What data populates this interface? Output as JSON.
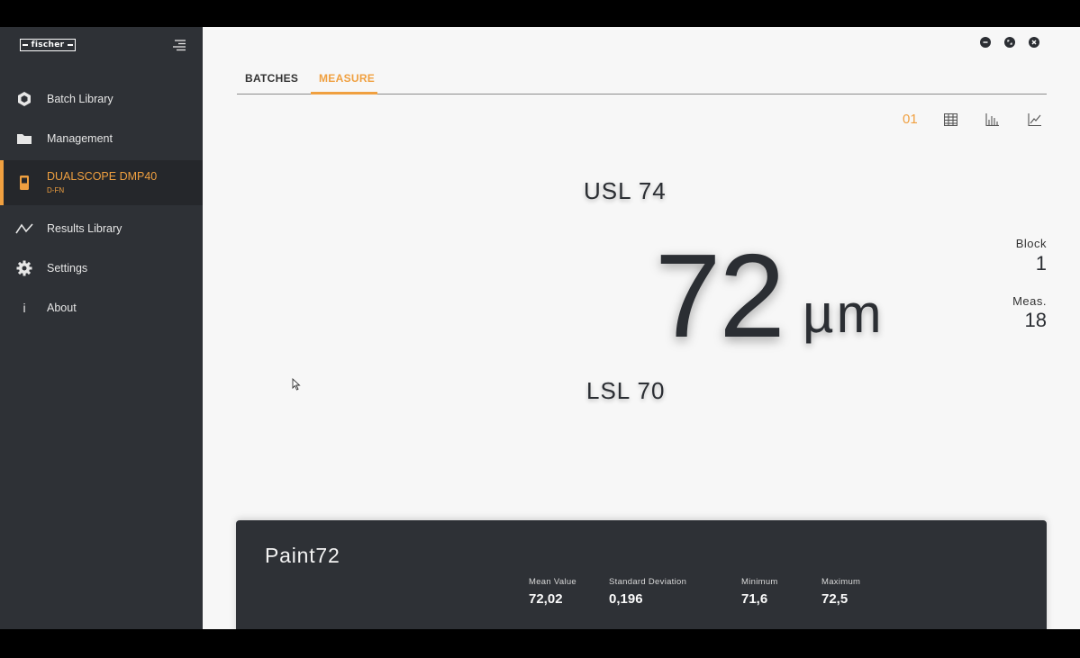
{
  "sidebar": {
    "logo_text": "fischer",
    "items": [
      {
        "label": "Batch Library",
        "icon": "hexagon-icon"
      },
      {
        "label": "Management",
        "icon": "folder-icon"
      },
      {
        "label": "DUALSCOPE DMP40",
        "sublabel": "D-FN",
        "icon": "device-icon",
        "active": true
      },
      {
        "label": "Results Library",
        "icon": "chart-line-icon"
      },
      {
        "label": "Settings",
        "icon": "gear-icon"
      },
      {
        "label": "About",
        "icon": "info-icon"
      }
    ]
  },
  "tabs": [
    {
      "label": "BATCHES",
      "active": false
    },
    {
      "label": "MEASURE",
      "active": true
    }
  ],
  "view_modes": {
    "single_label": "01",
    "icons": [
      "table-icon",
      "histogram-icon",
      "trend-chart-icon"
    ]
  },
  "measurement": {
    "usl": "USL 74",
    "lsl": "LSL 70",
    "value": "72",
    "unit": "µm",
    "block_label": "Block",
    "block_value": "1",
    "meas_label": "Meas.",
    "meas_value": "18"
  },
  "batch": {
    "name": "Paint72",
    "stats": [
      {
        "label": "Mean Value",
        "value": "72,02"
      },
      {
        "label": "Standard Deviation",
        "value": "0,196"
      },
      {
        "label": "Minimum",
        "value": "71,6"
      },
      {
        "label": "Maximum",
        "value": "72,5"
      }
    ]
  },
  "colors": {
    "accent": "#f0a040",
    "sidebar": "#2e3136",
    "background": "#f7f7f7"
  }
}
